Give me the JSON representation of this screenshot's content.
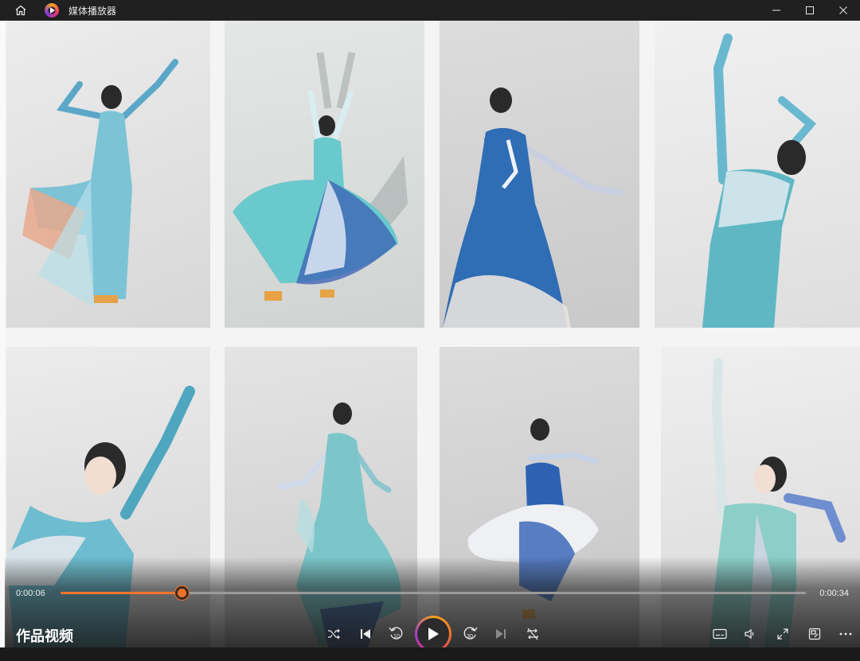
{
  "window": {
    "app_title": "媒体播放器",
    "home_icon": "home-icon",
    "app_icon": "media-player-logo",
    "controls": [
      "minimize-icon",
      "maximize-icon",
      "close-icon"
    ]
  },
  "video": {
    "title": "作品视频",
    "content": "eight photos of a woman in a blue-white gradient dance dress posing in a studio",
    "time_current": "0:00:06",
    "time_duration": "0:00:34",
    "progress": 0.162
  },
  "transport": {
    "shuffle": "shuffle-icon",
    "previous": "previous-icon",
    "rewind": "rewind-10-icon",
    "rewind_label": "10",
    "play": "play-icon",
    "forward": "forward-30-icon",
    "forward_label": "30",
    "next": "next-icon",
    "repeat": "repeat-off-icon"
  },
  "right_controls": [
    "subtitles-icon",
    "volume-icon",
    "fullscreen-icon",
    "mini-player-icon",
    "more-icon"
  ],
  "colors": {
    "accent": "#f0742b",
    "titlebar": "#202020",
    "dress_blue": "#2f6db5",
    "dress_teal": "#5fb7c4"
  }
}
